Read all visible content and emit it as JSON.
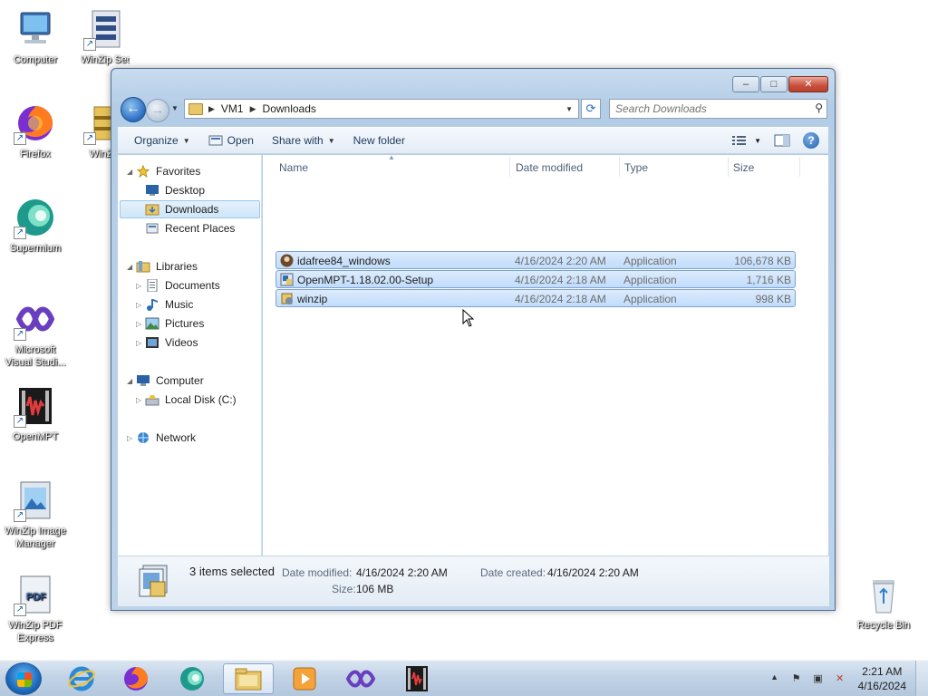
{
  "desktop": {
    "icons": [
      {
        "label": "Computer",
        "icon": "computer-icon"
      },
      {
        "label": "WinZip Secu...",
        "icon": "winzip-secure-icon"
      },
      {
        "label": "Firefox",
        "icon": "firefox-icon"
      },
      {
        "label": "WinZ...",
        "icon": "winzip-icon"
      },
      {
        "label": "Supermium",
        "icon": "supermium-icon"
      },
      {
        "label": "Microsoft Visual Studi...",
        "icon": "visual-studio-icon"
      },
      {
        "label": "OpenMPT",
        "icon": "openmpt-icon"
      },
      {
        "label": "WinZip Image Manager",
        "icon": "winzip-image-manager-icon"
      },
      {
        "label": "WinZip PDF Express",
        "icon": "winzip-pdf-express-icon"
      },
      {
        "label": "Recycle Bin",
        "icon": "recycle-bin-icon"
      }
    ]
  },
  "window": {
    "title": "Downloads",
    "caption": {
      "minimize": "‒",
      "maximize": "□",
      "close": "✕"
    },
    "address": {
      "crumbs": [
        "VM1",
        "Downloads"
      ]
    },
    "search": {
      "placeholder": "Search Downloads"
    },
    "toolbar": {
      "organize": "Organize",
      "open": "Open",
      "share": "Share with",
      "new_folder": "New folder",
      "help": "?"
    },
    "nav": {
      "favorites": "Favorites",
      "desktop": "Desktop",
      "downloads": "Downloads",
      "recent": "Recent Places",
      "libraries": "Libraries",
      "documents": "Documents",
      "music": "Music",
      "pictures": "Pictures",
      "videos": "Videos",
      "computer": "Computer",
      "local_disk": "Local Disk (C:)",
      "network": "Network"
    },
    "columns": {
      "name": "Name",
      "date": "Date modified",
      "type": "Type",
      "size": "Size"
    },
    "files": [
      {
        "name": "idafree84_windows",
        "date": "4/16/2024 2:20 AM",
        "type": "Application",
        "size": "106,678 KB"
      },
      {
        "name": "OpenMPT-1.18.02.00-Setup",
        "date": "4/16/2024 2:18 AM",
        "type": "Application",
        "size": "1,716 KB"
      },
      {
        "name": "winzip",
        "date": "4/16/2024 2:18 AM",
        "type": "Application",
        "size": "998 KB"
      }
    ],
    "details": {
      "selected": "3 items selected",
      "date_modified_label": "Date modified:",
      "date_modified": "4/16/2024 2:20 AM",
      "date_created_label": "Date created:",
      "date_created": "4/16/2024 2:20 AM",
      "size_label": "Size:",
      "size": "106 MB"
    }
  },
  "taskbar": {
    "pinned": [
      "internet-explorer-icon",
      "firefox-icon",
      "supermium-icon",
      "windows-explorer-icon",
      "media-player-icon",
      "visual-studio-icon",
      "openmpt-icon"
    ],
    "clock": {
      "time": "2:21 AM",
      "date": "4/16/2024"
    }
  }
}
